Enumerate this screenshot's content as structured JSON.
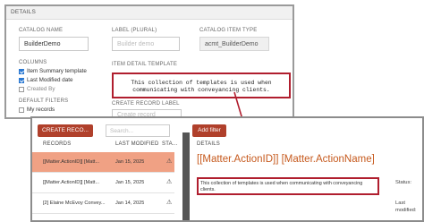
{
  "top_panel": {
    "section_title": "DETAILS",
    "catalog_name": {
      "label": "CATALOG NAME",
      "value": "BuilderDemo"
    },
    "label_plural": {
      "label": "LABEL (PLURAL)",
      "placeholder": "Builder demo"
    },
    "catalog_item_type": {
      "label": "CATALOG ITEM TYPE",
      "value": "acmt_BuilderDemo"
    },
    "columns": {
      "label": "COLUMNS",
      "items": [
        {
          "label": "Item Summary template",
          "checked": true
        },
        {
          "label": "Last Modified date",
          "checked": true
        },
        {
          "label": "Created By",
          "checked": false
        }
      ]
    },
    "default_filters": {
      "label": "DEFAULT FILTERS",
      "items": [
        {
          "label": "My records",
          "checked": false
        }
      ]
    },
    "item_detail_template": {
      "label": "ITEM DETAIL TEMPLATE",
      "line1": "This collection of templates is used when",
      "line2": "communicating with conveyancing clients."
    },
    "create_record_label": {
      "label": "CREATE RECORD LABEL",
      "placeholder": "Create record"
    }
  },
  "bottom_panel": {
    "create_button": "CREATE RECO...",
    "search_placeholder": "Search...",
    "add_filter_button": "Add filter",
    "columns": {
      "records": "RECORDS",
      "last_modified": "LAST MODIFIED",
      "status": "STA..."
    },
    "rows": [
      {
        "record": "[[Matter.ActionID]] [Matt...",
        "modified": "Jan 15, 2025",
        "status_icon": "warning-icon",
        "selected": true
      },
      {
        "record": "[[Matter.ActionID]] [Matt...",
        "modified": "Jan 15, 2025",
        "status_icon": "warning-icon",
        "selected": false
      },
      {
        "record": "[2] Elaine McEvoy Convey...",
        "modified": "Jan 14, 2025",
        "status_icon": "warning-icon",
        "selected": false
      }
    ],
    "details_label": "DETAILS",
    "matter_title_part1": "[[Matter.ActionID]]",
    "matter_title_part2": "[Matter.ActionName]",
    "description": "This collection of templates is used when communicating with conveyancing clients.",
    "status_label": "Status:",
    "last_label": "Last",
    "modified_label": "modified:"
  },
  "colors": {
    "accent_red": "#b0402b",
    "callout_border": "#b01e2e",
    "selected_row": "#f0a184",
    "title_orange": "#c65a1e"
  }
}
